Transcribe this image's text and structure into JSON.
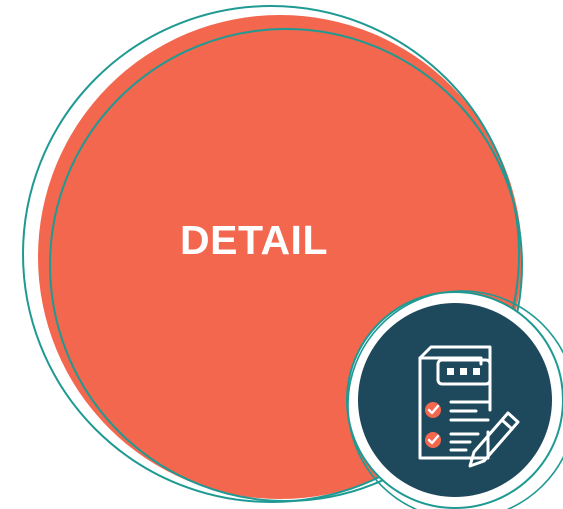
{
  "main_circle": {
    "label": "DETAIL",
    "fill_color": "#F2674E",
    "outline_color": "#1F9A93"
  },
  "badge": {
    "icon": "checklist-document-icon",
    "fill_color": "#1E495C",
    "outline_color": "#1F9A93",
    "icon_color": "#ffffff",
    "check_color": "#F2674E"
  }
}
